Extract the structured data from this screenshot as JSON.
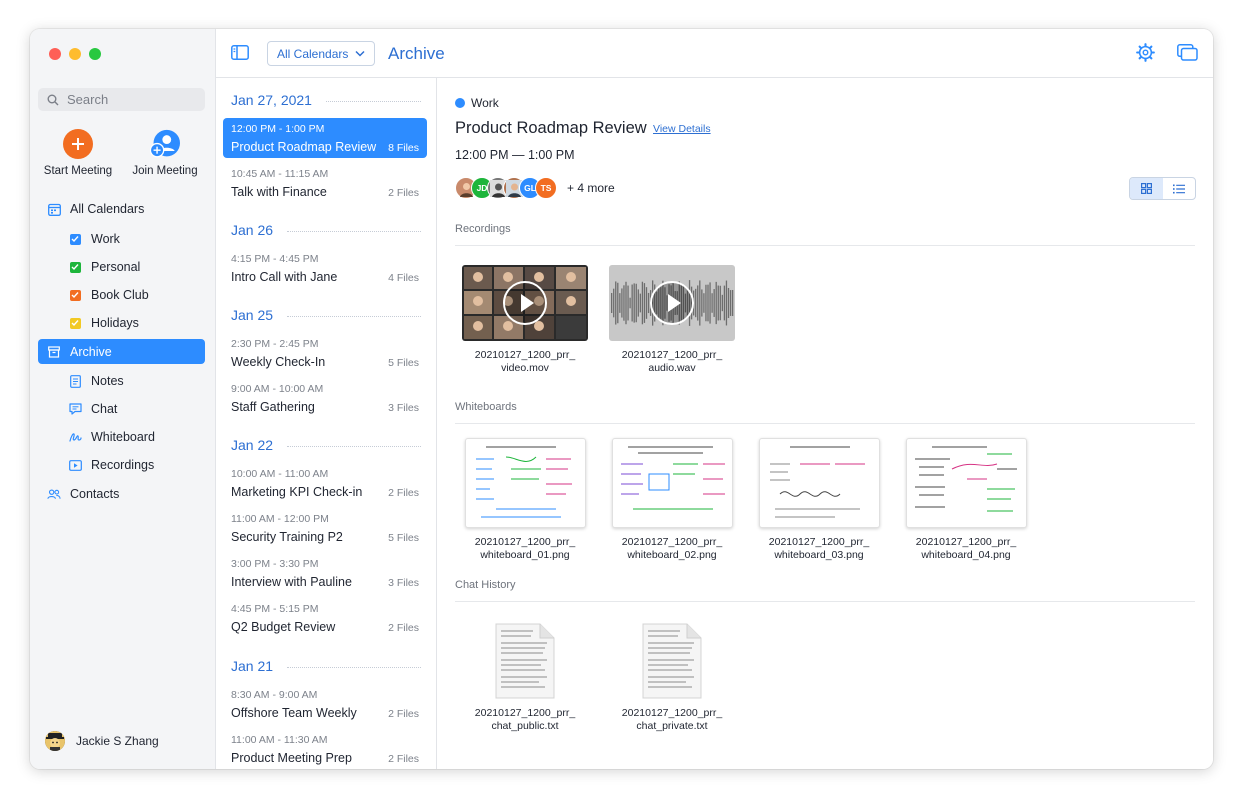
{
  "sidebar": {
    "search_placeholder": "Search",
    "start_meeting": "Start Meeting",
    "join_meeting": "Join Meeting",
    "all_calendars": "All Calendars",
    "calendars": [
      {
        "label": "Work",
        "color": "#2d8cff"
      },
      {
        "label": "Personal",
        "color": "#1db53b"
      },
      {
        "label": "Book Club",
        "color": "#f26d21"
      },
      {
        "label": "Holidays",
        "color": "#f2c924"
      }
    ],
    "archive": "Archive",
    "archive_items": [
      {
        "label": "Notes",
        "icon": "notes-icon"
      },
      {
        "label": "Chat",
        "icon": "chat-icon"
      },
      {
        "label": "Whiteboard",
        "icon": "whiteboard-icon"
      },
      {
        "label": "Recordings",
        "icon": "recordings-icon"
      }
    ],
    "contacts": "Contacts",
    "user_name": "Jackie S Zhang"
  },
  "topbar": {
    "calendar_select": "All Calendars",
    "title": "Archive"
  },
  "list": {
    "groups": [
      {
        "date": "Jan 27, 2021",
        "events": [
          {
            "time": "12:00 PM - 1:00 PM",
            "name": "Product Roadmap Review",
            "files": "8 Files",
            "selected": true
          },
          {
            "time": "10:45 AM - 11:15 AM",
            "name": "Talk with Finance",
            "files": "2 Files"
          }
        ]
      },
      {
        "date": "Jan 26",
        "events": [
          {
            "time": "4:15 PM - 4:45 PM",
            "name": "Intro Call with Jane",
            "files": "4 Files"
          }
        ]
      },
      {
        "date": "Jan 25",
        "events": [
          {
            "time": "2:30 PM - 2:45 PM",
            "name": "Weekly Check-In",
            "files": "5 Files"
          },
          {
            "time": "9:00 AM - 10:00 AM",
            "name": "Staff Gathering",
            "files": "3 Files"
          }
        ]
      },
      {
        "date": "Jan 22",
        "events": [
          {
            "time": "10:00 AM - 11:00 AM",
            "name": "Marketing KPI Check-in",
            "files": "2 Files"
          },
          {
            "time": "11:00 AM - 12:00 PM",
            "name": "Security Training P2",
            "files": "5 Files"
          },
          {
            "time": "3:00 PM - 3:30 PM",
            "name": "Interview with Pauline",
            "files": "3 Files"
          },
          {
            "time": "4:45 PM - 5:15 PM",
            "name": "Q2 Budget Review",
            "files": "2 Files"
          }
        ]
      },
      {
        "date": "Jan 21",
        "events": [
          {
            "time": "8:30 AM - 9:00 AM",
            "name": "Offshore Team Weekly",
            "files": "2 Files"
          },
          {
            "time": "11:00 AM - 11:30 AM",
            "name": "Product Meeting Prep",
            "files": "2 Files"
          }
        ]
      }
    ]
  },
  "detail": {
    "category": "Work",
    "title": "Product Roadmap Review",
    "view_details": "View Details",
    "time": "12:00 PM — 1:00 PM",
    "attendee_initials": [
      "JD",
      "GL",
      "TS"
    ],
    "more": "+ 4 more",
    "sections": {
      "recordings": "Recordings",
      "whiteboards": "Whiteboards",
      "chat": "Chat History"
    },
    "recordings": [
      {
        "line1": "20210127_1200_prr_",
        "line2": "video.mov"
      },
      {
        "line1": "20210127_1200_prr_",
        "line2": "audio.wav"
      }
    ],
    "whiteboards": [
      {
        "line1": "20210127_1200_prr_",
        "line2": "whiteboard_01.png"
      },
      {
        "line1": "20210127_1200_prr_",
        "line2": "whiteboard_02.png"
      },
      {
        "line1": "20210127_1200_prr_",
        "line2": "whiteboard_03.png"
      },
      {
        "line1": "20210127_1200_prr_",
        "line2": "whiteboard_04.png"
      }
    ],
    "chats": [
      {
        "line1": "20210127_1200_prr_",
        "line2": "chat_public.txt"
      },
      {
        "line1": "20210127_1200_prr_",
        "line2": "chat_private.txt"
      }
    ]
  }
}
